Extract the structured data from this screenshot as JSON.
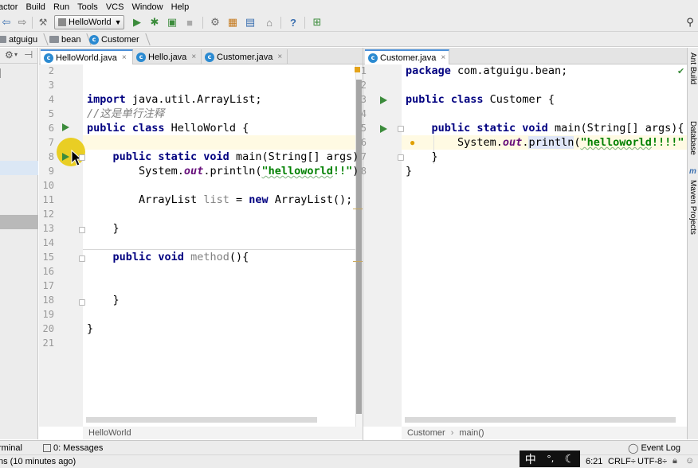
{
  "menu": [
    "actor",
    "Build",
    "Run",
    "Tools",
    "VCS",
    "Window",
    "Help"
  ],
  "toolbar": {
    "run_config": "HelloWorld",
    "help_glyph": "?"
  },
  "breadcrumb": [
    "atguigu",
    "bean",
    "Customer"
  ],
  "left_tabs": [
    {
      "label": "HelloWorld.java",
      "active": true
    },
    {
      "label": "Hello.java",
      "active": false
    },
    {
      "label": "Customer.java",
      "active": false
    }
  ],
  "right_tabs": [
    {
      "label": "Customer.java",
      "active": true
    }
  ],
  "left_editor": {
    "lines": [
      {
        "n": "2",
        "tokens": []
      },
      {
        "n": "3",
        "tokens": []
      },
      {
        "n": "4",
        "tokens": [
          [
            "kw",
            "import"
          ],
          [
            "t",
            " java.util.ArrayList;"
          ]
        ]
      },
      {
        "n": "5",
        "tokens": [
          [
            "cmt",
            "//这是单行注释"
          ]
        ]
      },
      {
        "n": "6",
        "tokens": [
          [
            "kw",
            "public class"
          ],
          [
            "t",
            " HelloWorld {"
          ]
        ]
      },
      {
        "n": "7",
        "tokens": []
      },
      {
        "n": "8",
        "tokens": [
          [
            "t",
            "    "
          ],
          [
            "kw",
            "public static void"
          ],
          [
            "t",
            " main(String[] args)"
          ]
        ]
      },
      {
        "n": "9",
        "tokens": [
          [
            "t",
            "        System."
          ],
          [
            "fld",
            "out"
          ],
          [
            "t",
            ".println("
          ],
          [
            "strw",
            "\"helloworld"
          ],
          [
            "str",
            "!!\""
          ],
          [
            "t",
            ")"
          ]
        ]
      },
      {
        "n": "10",
        "tokens": []
      },
      {
        "n": "11",
        "tokens": [
          [
            "t",
            "        ArrayList "
          ],
          [
            "gray",
            "list"
          ],
          [
            "t",
            " = "
          ],
          [
            "kw",
            "new"
          ],
          [
            "t",
            " ArrayList();"
          ]
        ]
      },
      {
        "n": "12",
        "tokens": []
      },
      {
        "n": "13",
        "tokens": [
          [
            "t",
            "    }"
          ]
        ]
      },
      {
        "n": "14",
        "tokens": []
      },
      {
        "n": "15",
        "tokens": [
          [
            "t",
            "    "
          ],
          [
            "kw",
            "public void"
          ],
          [
            "t",
            " "
          ],
          [
            "gray",
            "method"
          ],
          [
            "t",
            "(){"
          ]
        ]
      },
      {
        "n": "16",
        "tokens": []
      },
      {
        "n": "17",
        "tokens": []
      },
      {
        "n": "18",
        "tokens": [
          [
            "t",
            "    }"
          ]
        ]
      },
      {
        "n": "19",
        "tokens": []
      },
      {
        "n": "20",
        "tokens": [
          [
            "t",
            "}"
          ]
        ]
      },
      {
        "n": "21",
        "tokens": []
      }
    ],
    "footer": "HelloWorld"
  },
  "right_editor": {
    "lines": [
      {
        "n": "1",
        "tokens": [
          [
            "kw",
            "package"
          ],
          [
            "t",
            " com.atguigu.bean;"
          ]
        ]
      },
      {
        "n": "2",
        "tokens": []
      },
      {
        "n": "3",
        "tokens": [
          [
            "kw",
            "public class"
          ],
          [
            "t",
            " Customer {"
          ]
        ]
      },
      {
        "n": "4",
        "tokens": []
      },
      {
        "n": "5",
        "tokens": [
          [
            "t",
            "    "
          ],
          [
            "kw",
            "public static void"
          ],
          [
            "t",
            " main(String[] args){"
          ]
        ]
      },
      {
        "n": "6",
        "tokens": [
          [
            "t",
            "        System."
          ],
          [
            "fld",
            "out"
          ],
          [
            "t",
            "."
          ],
          [
            "hl",
            "println"
          ],
          [
            "t",
            "("
          ],
          [
            "strw",
            "\"helloworld"
          ],
          [
            "str",
            "!!!!\""
          ]
        ]
      },
      {
        "n": "7",
        "tokens": [
          [
            "t",
            "    }"
          ]
        ]
      },
      {
        "n": "8",
        "tokens": [
          [
            "t",
            "}"
          ]
        ]
      }
    ],
    "footer_class": "Customer",
    "footer_method": "main()"
  },
  "right_strip": [
    "Ant Build",
    "Database",
    "Maven Projects"
  ],
  "tool_windows": {
    "terminal": "rminal",
    "messages": "0: Messages",
    "event_log": "Event Log"
  },
  "status": {
    "message": "ns (10 minutes ago)",
    "position": "6:21",
    "line_sep": "CRLF÷",
    "encoding": "UTF-8÷"
  },
  "ime": [
    "中",
    "°,",
    "☾"
  ],
  "colors": {
    "keyword": "#000080",
    "string": "#008000",
    "comment": "#808080",
    "run": "#3c8c3c",
    "accent": "#4a8fd8"
  }
}
